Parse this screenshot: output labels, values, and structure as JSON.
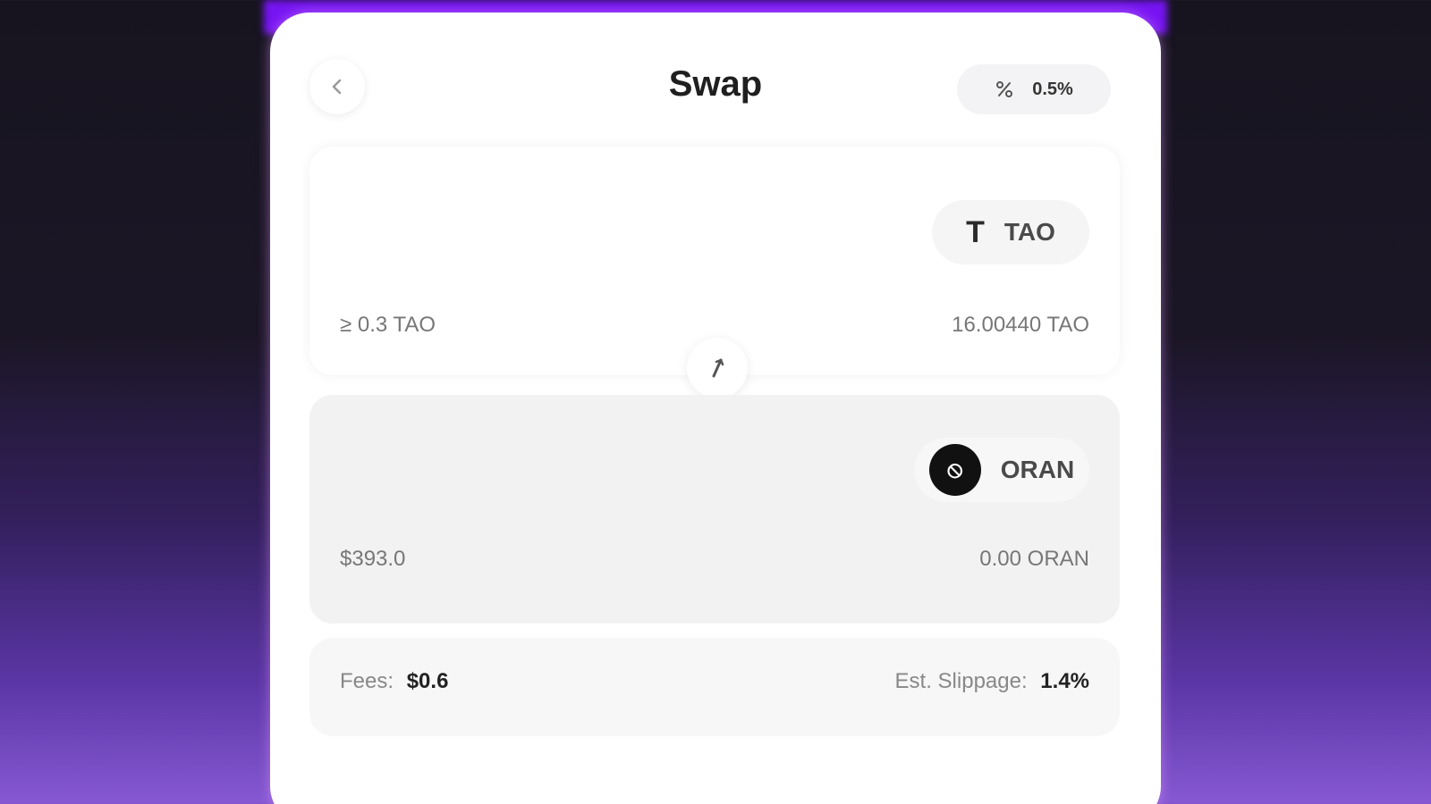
{
  "header": {
    "title": "Swap",
    "slippage_value": "0.5%"
  },
  "from_panel": {
    "token_symbol_glyph": "T",
    "token_label": "TAO",
    "left_value": "≥ 0.3 TAO",
    "right_value": "16.00440 TAO"
  },
  "to_panel": {
    "token_label": "ORAN",
    "left_value": "$393.0",
    "right_value": "0.00 ORAN"
  },
  "fees": {
    "label": "Fees:",
    "value": "$0.6",
    "slippage_label": "Est. Slippage:",
    "slippage_value": "1.4%"
  },
  "icons": {
    "back": "chevron-left-icon",
    "slippage": "percent-icon",
    "switch": "swap-vertical-icon",
    "oran_logo": "circle-logo-icon"
  },
  "colors": {
    "accent": "#7614f2",
    "background_top": "#17141f",
    "background_bottom": "#8759d3"
  }
}
